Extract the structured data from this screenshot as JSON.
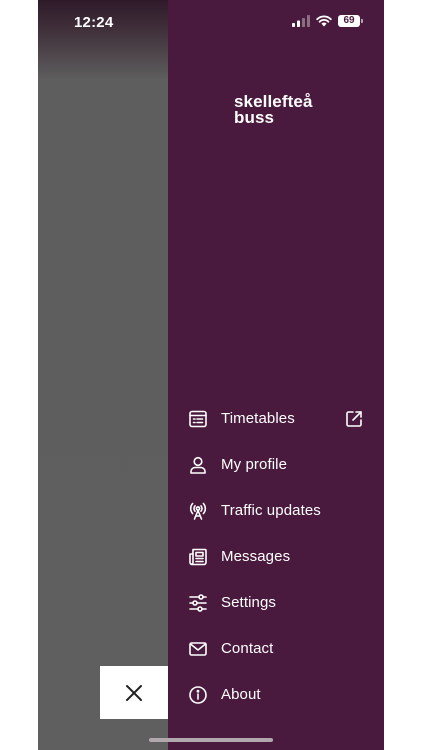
{
  "status_bar": {
    "time": "12:24",
    "battery": "69"
  },
  "brand": {
    "line1": "skellefteå",
    "line2": "buss"
  },
  "menu": {
    "items": [
      {
        "label": "Timetables",
        "icon": "timetable-icon",
        "external": true
      },
      {
        "label": "My profile",
        "icon": "person-icon"
      },
      {
        "label": "Traffic updates",
        "icon": "broadcast-icon"
      },
      {
        "label": "Messages",
        "icon": "newspaper-icon"
      },
      {
        "label": "Settings",
        "icon": "sliders-icon"
      },
      {
        "label": "Contact",
        "icon": "envelope-icon"
      },
      {
        "label": "About",
        "icon": "info-icon"
      }
    ]
  },
  "close_button": {
    "icon": "close-icon"
  },
  "colors": {
    "drawer_background": "#4a1a3e",
    "backdrop": "#5f5f5f",
    "text": "#ffffff"
  }
}
